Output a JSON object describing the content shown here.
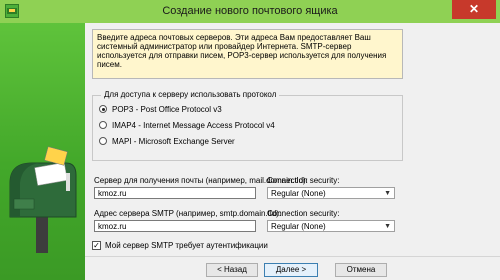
{
  "window": {
    "title": "Создание нового почтового ящика",
    "close_glyph": "✕"
  },
  "info_text": "Введите адреса почтовых серверов. Эти адреса Вам предоставляет Ваш системный администратор или провайдер Интернета. SMTP-сервер используется для отправки писем, POP3-сервер используется для получения писем.",
  "protocol_group": {
    "label": "Для доступа к серверу использовать протокол",
    "options": [
      {
        "label": "POP3 - Post Office Protocol v3",
        "checked": true
      },
      {
        "label": "IMAP4 - Internet Message Access Protocol v4",
        "checked": false
      },
      {
        "label": "MAPI - Microsoft Exchange Server",
        "checked": false
      }
    ]
  },
  "incoming": {
    "label": "Сервер для получения почты  (например, mail.domain.tld):",
    "value": "kmoz.ru",
    "security_label": "Connection security:",
    "security_value": "Regular (None)"
  },
  "outgoing": {
    "label": "Адрес сервера SMTP (например, smtp.domain.tld):",
    "value": "kmoz.ru",
    "security_label": "Connection security:",
    "security_value": "Regular (None)"
  },
  "auth_checkbox": {
    "label": "Мой сервер SMTP требует аутентификации",
    "checked": true,
    "mark": "✓"
  },
  "buttons": {
    "back": "<  Назад",
    "next": "Далее  >",
    "cancel": "Отмена"
  },
  "icons": {
    "app": "mailbox-app-icon",
    "side": "mailbox-illustration"
  },
  "colors": {
    "titlebar": "#8fd154",
    "side_panel": "#43a82a",
    "info_bg": "#fff6cd",
    "close": "#c7392b"
  }
}
